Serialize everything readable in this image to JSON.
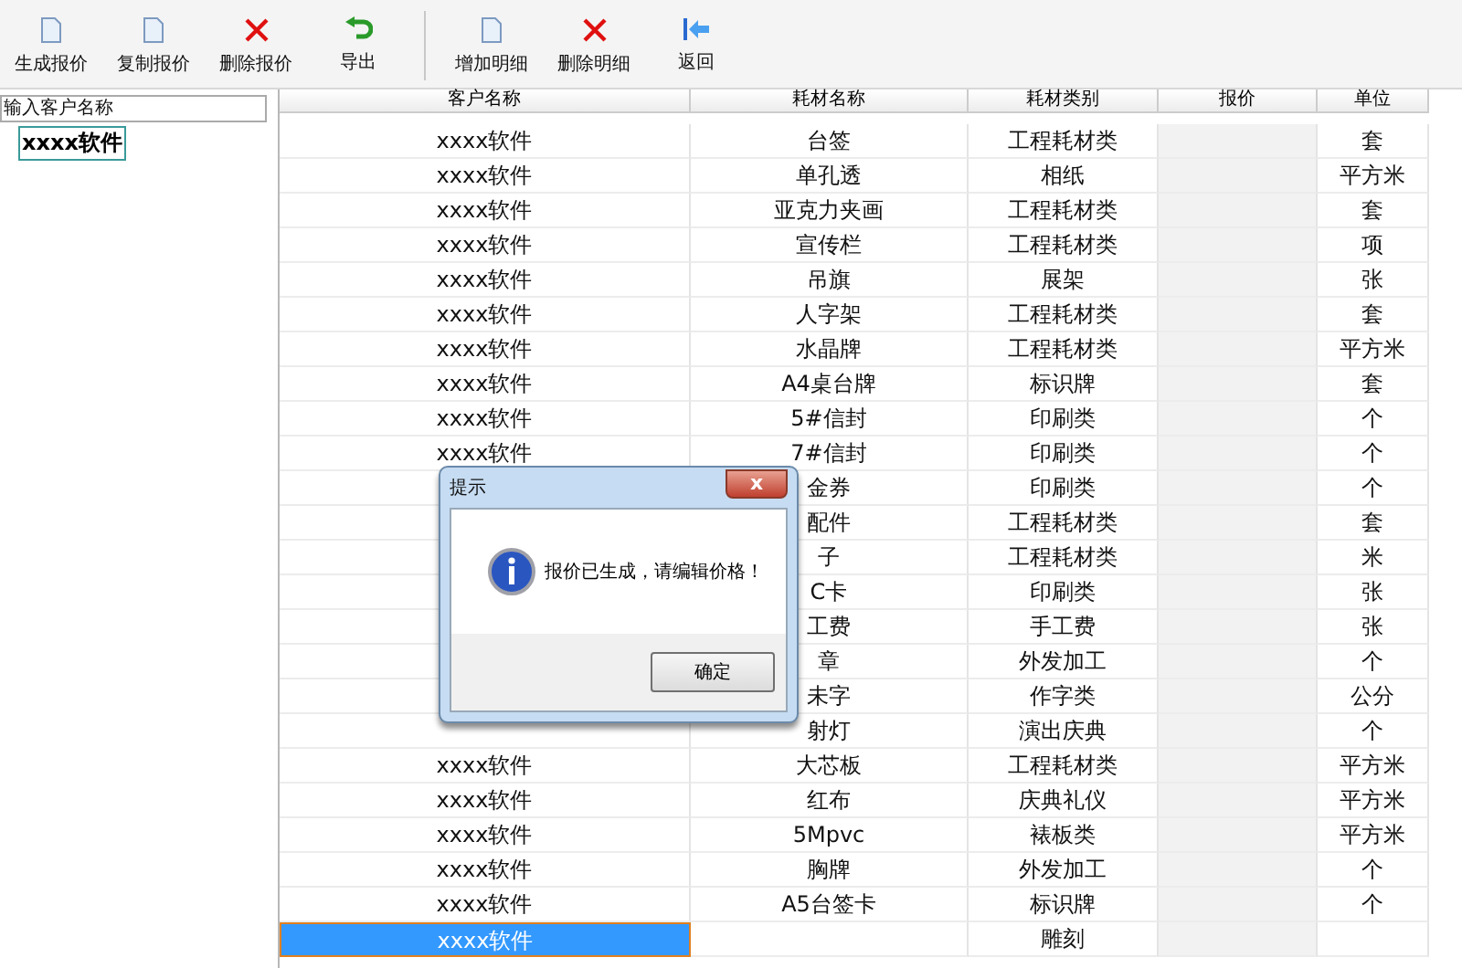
{
  "toolbar": [
    [
      {
        "label": "生成报价",
        "kind": "doc"
      },
      {
        "label": "复制报价",
        "kind": "doc"
      },
      {
        "label": "删除报价",
        "kind": "delete"
      },
      {
        "label": "导出",
        "kind": "export"
      }
    ],
    [
      {
        "label": "增加明细",
        "kind": "doc"
      },
      {
        "label": "删除明细",
        "kind": "delete"
      },
      {
        "label": "返回",
        "kind": "back"
      }
    ]
  ],
  "search": {
    "placeholder": "输入客户名称"
  },
  "tree": [
    {
      "label": "xxxx软件",
      "selected": true
    }
  ],
  "table": {
    "columns": [
      "客户名称",
      "耗材名称",
      "耗材类别",
      "报价",
      "单位"
    ],
    "rows": [
      {
        "client": "xxxx软件",
        "name": "台签",
        "category": "工程耗材类",
        "unit": "套",
        "selected": false
      },
      {
        "client": "xxxx软件",
        "name": "单孔透",
        "category": "相纸",
        "unit": "平方米",
        "selected": false
      },
      {
        "client": "xxxx软件",
        "name": "亚克力夹画",
        "category": "工程耗材类",
        "unit": "套",
        "selected": false
      },
      {
        "client": "xxxx软件",
        "name": "宣传栏",
        "category": "工程耗材类",
        "unit": "项",
        "selected": false
      },
      {
        "client": "xxxx软件",
        "name": "吊旗",
        "category": "展架",
        "unit": "张",
        "selected": false
      },
      {
        "client": "xxxx软件",
        "name": "人字架",
        "category": "工程耗材类",
        "unit": "套",
        "selected": false
      },
      {
        "client": "xxxx软件",
        "name": "水晶牌",
        "category": "工程耗材类",
        "unit": "平方米",
        "selected": false
      },
      {
        "client": "xxxx软件",
        "name": "A4桌台牌",
        "category": "标识牌",
        "unit": "套",
        "selected": false
      },
      {
        "client": "xxxx软件",
        "name": "5#信封",
        "category": "印刷类",
        "unit": "个",
        "selected": false
      },
      {
        "client": "xxxx软件",
        "name": "7#信封",
        "category": "印刷类",
        "unit": "个",
        "selected": false
      },
      {
        "name": "金券",
        "category": "印刷类",
        "unit": "个",
        "selected": false
      },
      {
        "name": "配件",
        "category": "工程耗材类",
        "unit": "套",
        "selected": false
      },
      {
        "name": "子",
        "category": "工程耗材类",
        "unit": "米",
        "selected": false
      },
      {
        "name": "C卡",
        "category": "印刷类",
        "unit": "张",
        "selected": false
      },
      {
        "name": "工费",
        "category": "手工费",
        "unit": "张",
        "selected": false
      },
      {
        "name": "章",
        "category": "外发加工",
        "unit": "个",
        "selected": false
      },
      {
        "name": "未字",
        "category": "作字类",
        "unit": "公分",
        "selected": false
      },
      {
        "name": "射灯",
        "category": "演出庆典",
        "unit": "个",
        "selected": false
      },
      {
        "client": "xxxx软件",
        "name": "大芯板",
        "category": "工程耗材类",
        "unit": "平方米",
        "selected": false
      },
      {
        "client": "xxxx软件",
        "name": "红布",
        "category": "庆典礼仪",
        "unit": "平方米",
        "selected": false
      },
      {
        "client": "xxxx软件",
        "name": "5Mpvc",
        "category": "裱板类",
        "unit": "平方米",
        "selected": false
      },
      {
        "client": "xxxx软件",
        "name": "胸牌",
        "category": "外发加工",
        "unit": "个",
        "selected": false
      },
      {
        "client": "xxxx软件",
        "name": "A5台签卡",
        "category": "标识牌",
        "unit": "个",
        "selected": false
      },
      {
        "client": "xxxx软件",
        "category": "雕刻",
        "selected": true
      }
    ]
  },
  "dialog": {
    "title": "提示",
    "close": "x",
    "message": "报价已生成，请编辑价格！",
    "button": "确定"
  }
}
